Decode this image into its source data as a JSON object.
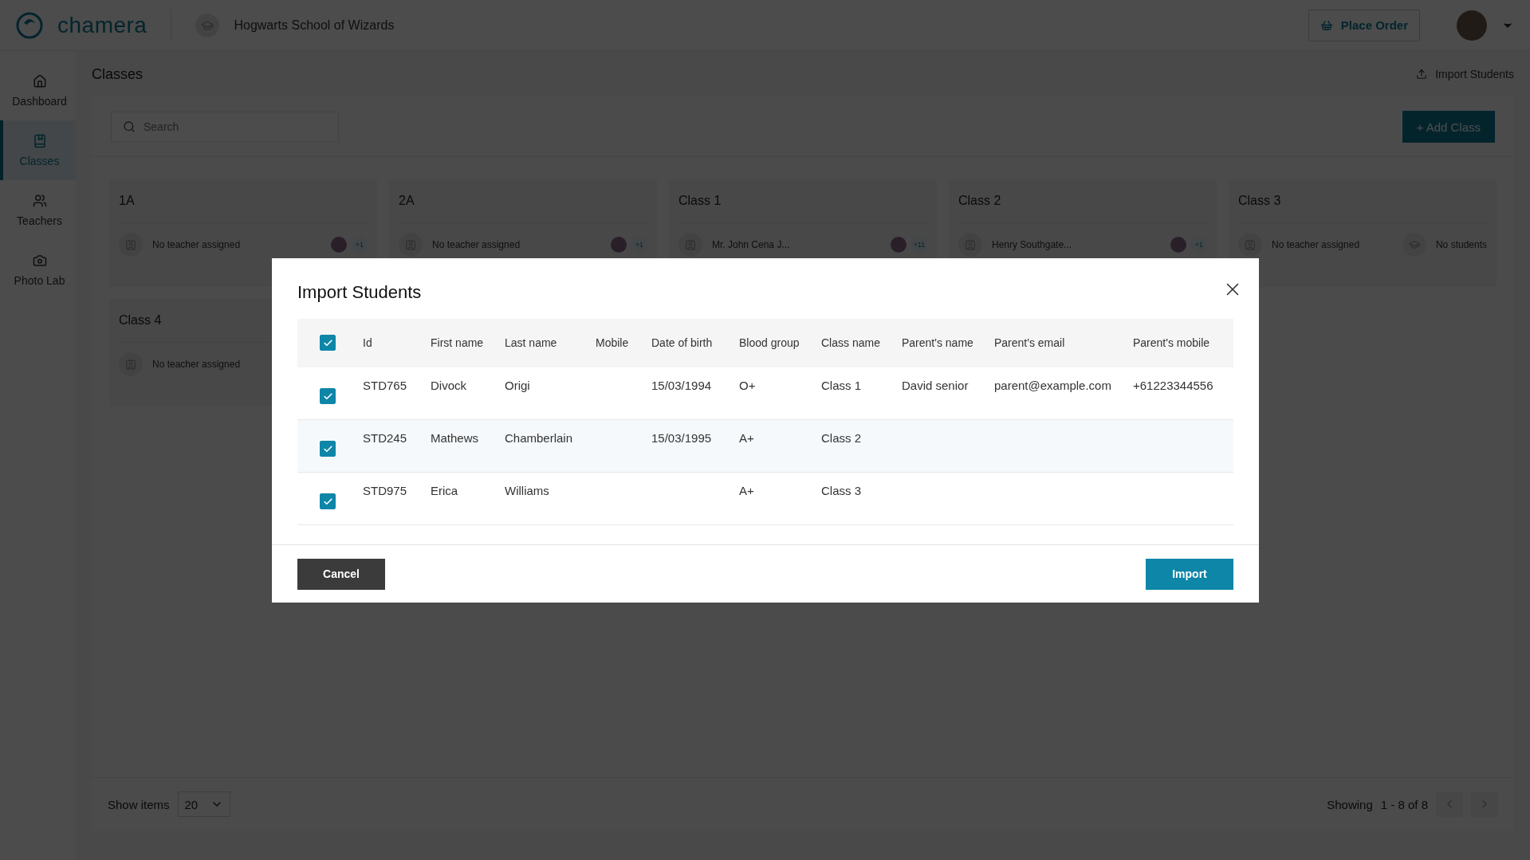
{
  "header": {
    "logo_text": "chamera",
    "school_name": "Hogwarts School of Wizards",
    "place_order": "Place Order"
  },
  "sidebar": {
    "items": [
      {
        "label": "Dashboard",
        "selected": false
      },
      {
        "label": "Classes",
        "selected": true
      },
      {
        "label": "Teachers",
        "selected": false
      },
      {
        "label": "Photo Lab",
        "selected": false
      }
    ]
  },
  "page": {
    "title": "Classes",
    "import_link": "Import Students",
    "search": {
      "placeholder": "Search"
    },
    "add_button": "+ Add Class"
  },
  "cards": [
    {
      "name": "1A",
      "teacher": "No teacher assigned",
      "kind": "members",
      "count": "+1"
    },
    {
      "name": "2A",
      "teacher": "No teacher assigned",
      "kind": "members",
      "count": "+1"
    },
    {
      "name": "Class 1",
      "teacher": "Mr. John Cena J...",
      "kind": "members",
      "count": "+11"
    },
    {
      "name": "Class 2",
      "teacher": "Henry Southgate...",
      "kind": "members",
      "count": "+1"
    },
    {
      "name": "Class 3",
      "teacher": "No teacher assigned",
      "kind": "empty",
      "students_text": "No students"
    },
    {
      "name": "Class 4",
      "teacher": "No teacher assigned",
      "kind": "hidden"
    }
  ],
  "pagination": {
    "show_items": "Show items",
    "page_size": "20",
    "showing": "Showing",
    "range": "1 - 8 of 8"
  },
  "modal": {
    "title": "Import Students",
    "all_checked": true,
    "columns": [
      "Id",
      "First name",
      "Last name",
      "Mobile",
      "Date of birth",
      "Blood group",
      "Class name",
      "Parent's name",
      "Parent's email",
      "Parent's mobile"
    ],
    "rows": [
      {
        "checked": true,
        "cells": [
          "STD765",
          "Divock",
          "Origi",
          "",
          "15/03/1994",
          "O+",
          "Class 1",
          "David senior",
          "parent@example.com",
          "+61223344556"
        ]
      },
      {
        "checked": true,
        "cells": [
          "STD245",
          "Mathews",
          "Chamberlain",
          "",
          "15/03/1995",
          "A+",
          "Class 2",
          "",
          "",
          ""
        ]
      },
      {
        "checked": true,
        "cells": [
          "STD975",
          "Erica",
          "Williams",
          "",
          "",
          "A+",
          "Class 3",
          "",
          "",
          ""
        ]
      }
    ],
    "cancel": "Cancel",
    "import": "Import"
  }
}
